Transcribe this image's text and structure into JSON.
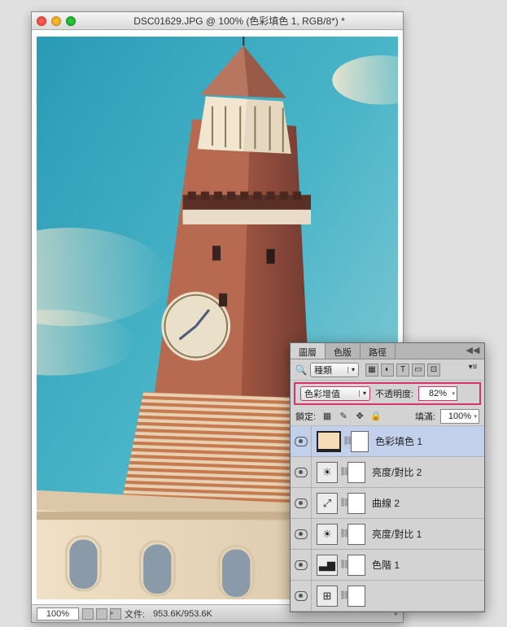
{
  "window": {
    "title": "DSC01629.JPG @ 100% (色彩填色 1, RGB/8*) *",
    "zoom": "100%",
    "file_label": "文件:",
    "file_size": "953.6K/953.6K"
  },
  "panel": {
    "tabs": {
      "layers": "圖層",
      "channels": "色版",
      "paths": "路徑"
    },
    "search": {
      "icon": "🔍",
      "kind_label": "種類"
    },
    "filter_icons": [
      "▦",
      "◐",
      "T",
      "▭",
      "⊡"
    ],
    "blend_mode": "色彩增值",
    "opacity_label": "不透明度:",
    "opacity_value": "82%",
    "lock_label": "鎖定:",
    "lock_icons": [
      "▦",
      "✎",
      "✥",
      "🔒"
    ],
    "fill_label": "填滿:",
    "fill_value": "100%",
    "layers": [
      {
        "name": "色彩填色 1",
        "type": "fill",
        "glyph": "",
        "selected": true
      },
      {
        "name": "亮度/對比 2",
        "type": "adj",
        "glyph": "☀",
        "selected": false
      },
      {
        "name": "曲線 2",
        "type": "adj",
        "glyph": "⤢",
        "selected": false
      },
      {
        "name": "亮度/對比 1",
        "type": "adj",
        "glyph": "☀",
        "selected": false
      },
      {
        "name": "色階 1",
        "type": "adj",
        "glyph": "▃▆",
        "selected": false
      },
      {
        "name": "",
        "type": "adj",
        "glyph": "⊞",
        "selected": false
      }
    ]
  }
}
